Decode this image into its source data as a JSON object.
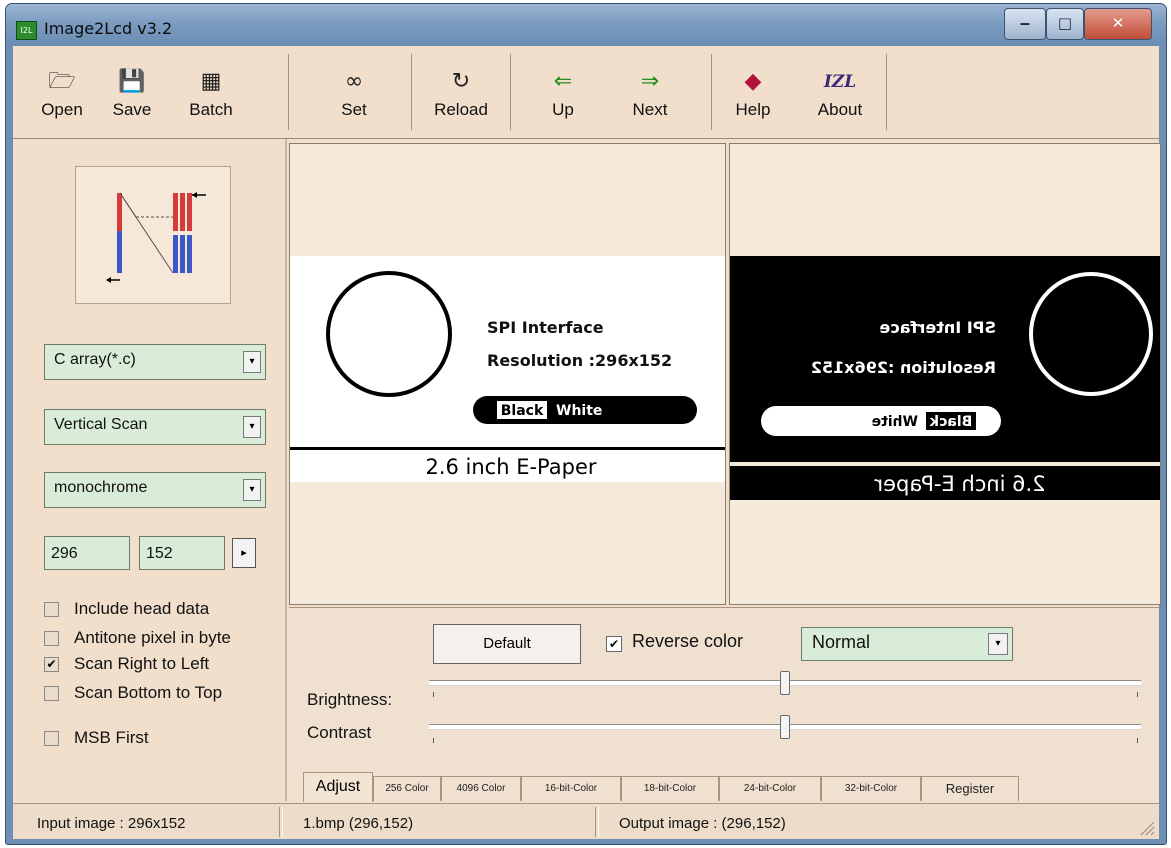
{
  "window": {
    "title": "Image2Lcd v3.2",
    "app_icon_text": "I2L",
    "minimize": "‒",
    "maximize": "□",
    "close": "✕"
  },
  "toolbar": [
    {
      "label": "Open",
      "icon": "open-icon"
    },
    {
      "label": "Save",
      "icon": "floppy-icon"
    },
    {
      "label": "Batch",
      "icon": "batch-icon"
    },
    {
      "label": "Set",
      "icon": "glasses-icon"
    },
    {
      "label": "Reload",
      "icon": "reload-icon"
    },
    {
      "label": "Up",
      "icon": "arrow-left-icon"
    },
    {
      "label": "Next",
      "icon": "arrow-right-icon"
    },
    {
      "label": "Help",
      "icon": "help-book-icon"
    },
    {
      "label": "About",
      "icon": "about-logo-icon"
    }
  ],
  "toolbar_glyphs": {
    "open": "🗁",
    "save": "💾",
    "batch": "▦",
    "set": "∞",
    "reload": "↻",
    "up": "⇐",
    "next": "⇒",
    "help": "◆",
    "about": "IZL"
  },
  "left": {
    "output_format": "C array(*.c)",
    "scan_mode": "Vertical Scan",
    "color_mode": "monochrome",
    "width": "296",
    "height": "152",
    "apply_glyph": "▸",
    "dropdown_glyph": "▾",
    "checkboxes": [
      {
        "label": "Include head data",
        "checked": false
      },
      {
        "label": "Antitone pixel in byte",
        "checked": false
      },
      {
        "label": "Scan Right to Left",
        "checked": true
      },
      {
        "label": "Scan Bottom to Top",
        "checked": false
      },
      {
        "label": "MSB First",
        "checked": false
      }
    ]
  },
  "input_preview": {
    "line1": "SPI Interface",
    "line2": "Resolution :296x152",
    "badge_a": "Black",
    "badge_b": "White",
    "caption": "2.6 inch E-Paper"
  },
  "output_preview": {
    "line1": "SPI Interface",
    "line2": "Resolution :296x152",
    "badge_a": "Black",
    "badge_b": "White",
    "caption": "2.6 inch E-Paper"
  },
  "adjust": {
    "default_button": "Default",
    "reverse_color_label": "Reverse color",
    "reverse_color_checked": true,
    "mode": "Normal",
    "brightness_label": "Brightness:",
    "contrast_label": "Contrast",
    "brightness_level": 0.5,
    "contrast_level": 0.5,
    "check_glyph": "✔"
  },
  "tabs": [
    {
      "label": "Adjust",
      "active": true
    },
    {
      "label": "256 Color",
      "active": false
    },
    {
      "label": "4096 Color",
      "active": false
    },
    {
      "label": "16-bit-Color",
      "active": false
    },
    {
      "label": "18-bit-Color",
      "active": false
    },
    {
      "label": "24-bit-Color",
      "active": false
    },
    {
      "label": "32-bit-Color",
      "active": false
    },
    {
      "label": "Register",
      "active": false
    }
  ],
  "status": {
    "input": "Input image : 296x152",
    "file": "1.bmp  (296,152)",
    "output": "Output image : (296,152)"
  }
}
